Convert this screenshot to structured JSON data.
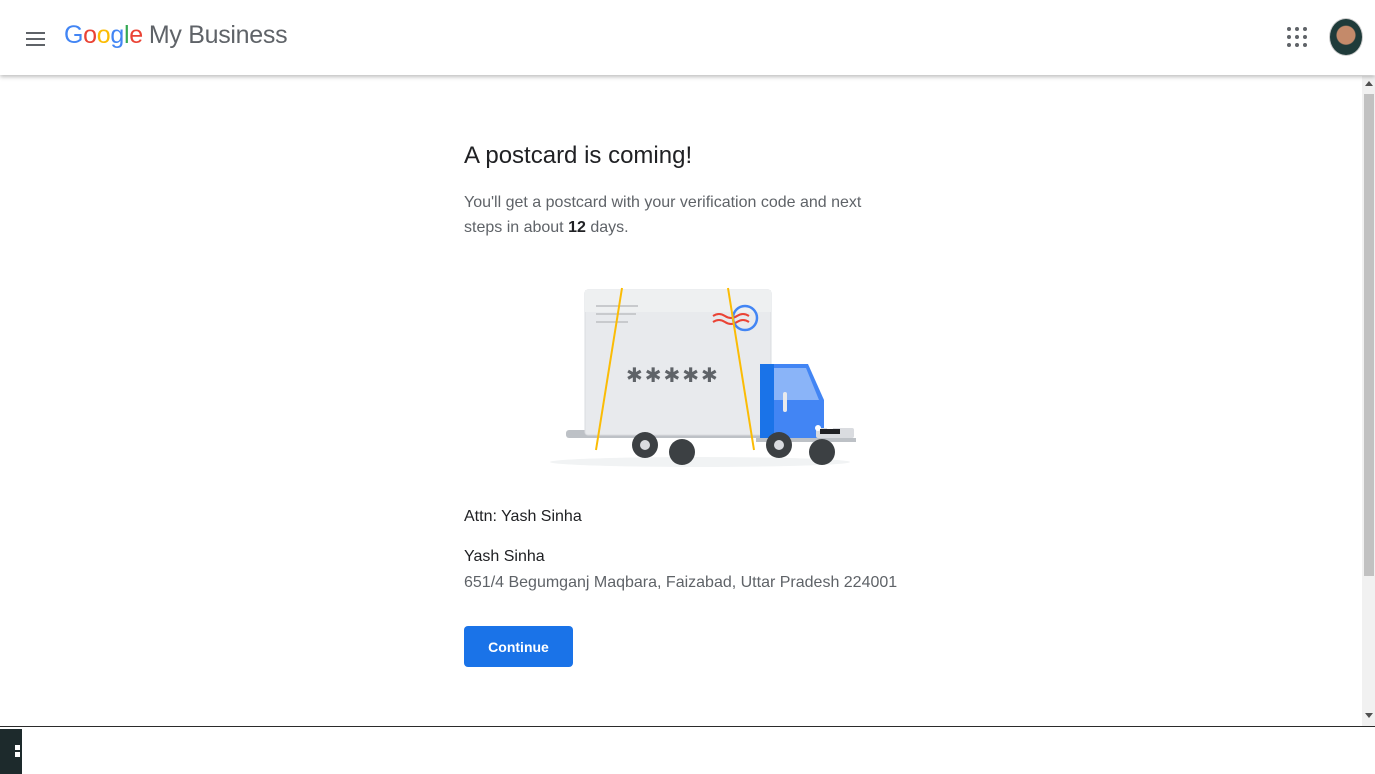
{
  "header": {
    "logo_letters": [
      "G",
      "o",
      "o",
      "g",
      "l",
      "e"
    ],
    "product_name": "My Business"
  },
  "icons": {
    "menu": "hamburger-menu-icon",
    "apps": "apps-grid-icon",
    "avatar": "account-avatar"
  },
  "main": {
    "title": "A postcard is coming!",
    "subtitle_prefix": "You'll get a postcard with your verification code and next steps in about ",
    "subtitle_days": "12",
    "subtitle_suffix": " days.",
    "postcard_code_mask": "✱✱✱✱✱",
    "attn": "Attn: Yash Sinha",
    "recipient_name": "Yash Sinha",
    "address": "651/4 Begumganj Maqbara, Faizabad, Uttar Pradesh 224001",
    "continue_label": "Continue"
  },
  "colors": {
    "google_blue": "#4285f4",
    "google_red": "#ea4335",
    "google_yellow": "#fbbc05",
    "google_green": "#34a853",
    "primary_button": "#1a73e8",
    "truck_blue": "#4285f4"
  }
}
